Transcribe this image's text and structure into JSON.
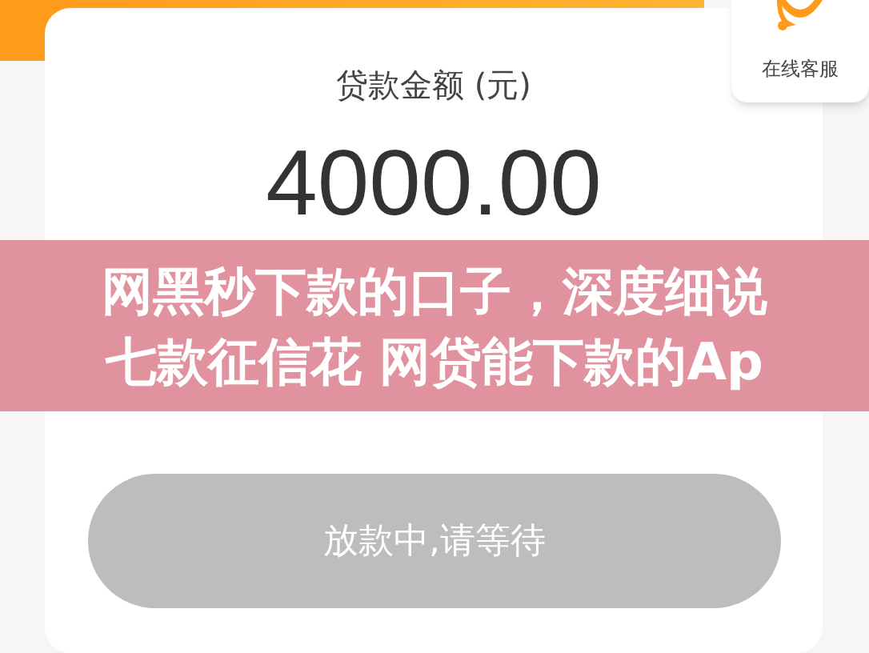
{
  "card": {
    "label": "贷款金额 (元)",
    "amount": "4000.00"
  },
  "service_button": {
    "label": "在线客服"
  },
  "caption_banner": {
    "lines": [
      "网黑秒下款的口子，深度细说",
      "七款征信花 网贷能下款的Ap"
    ]
  },
  "action_button": {
    "label": "放款中,请等待",
    "disabled": true
  }
}
